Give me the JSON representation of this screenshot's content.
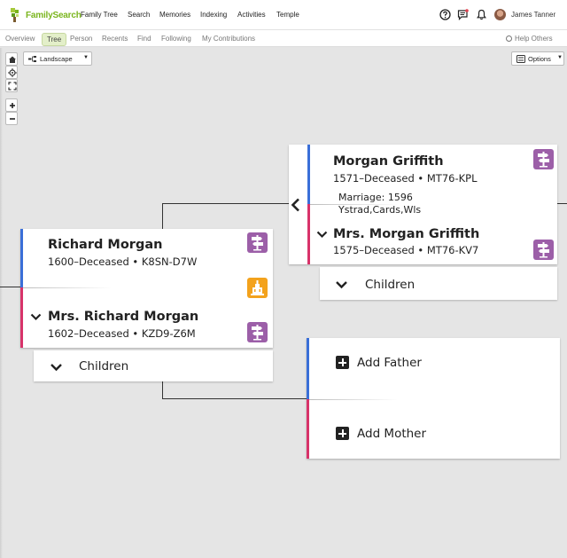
{
  "brand": {
    "name": "FamilySearch",
    "color": "#7ab51d"
  },
  "topnav": {
    "items": [
      "Family Tree",
      "Search",
      "Memories",
      "Indexing",
      "Activities",
      "Temple"
    ],
    "icons": [
      "help-icon",
      "messages-icon",
      "notifications-icon"
    ],
    "user_name": "James Tanner"
  },
  "subnav": {
    "items": [
      "Overview",
      "Tree",
      "Person",
      "Recents",
      "Find",
      "Following",
      "My Contributions"
    ],
    "active": "Tree",
    "help_label": "Help Others"
  },
  "toolbar": {
    "view_select": "Landscape",
    "options_label": "Options",
    "controls": [
      "home-icon",
      "recenter-icon",
      "fullscreen-icon",
      "zoom-in-icon",
      "zoom-out-icon"
    ]
  },
  "colors": {
    "male": "#3a6fd8",
    "female": "#d8336a",
    "ordinance_purple": "#9c5fa8",
    "temple_orange": "#f3a21c"
  },
  "couple_left": {
    "husband": {
      "name": "Richard Morgan",
      "dates": "1600–Deceased",
      "pid": "K8SN-D7W"
    },
    "wife": {
      "name": "Mrs. Richard Morgan",
      "dates": "1602–Deceased",
      "pid": "KZD9-Z6M"
    },
    "children_label": "Children"
  },
  "couple_right": {
    "husband": {
      "name": "Morgan Griffith",
      "dates": "1571–Deceased",
      "pid": "MT76-KPL"
    },
    "marriage_line1": "Marriage: 1596",
    "marriage_line2": "Ystrad,Cards,Wls",
    "wife": {
      "name": "Mrs. Morgan Griffith",
      "dates": "1575–Deceased",
      "pid": "MT76-KV7"
    },
    "children_label": "Children"
  },
  "add_parents": {
    "father_label": "Add Father",
    "mother_label": "Add Mother"
  },
  "separator": "•"
}
